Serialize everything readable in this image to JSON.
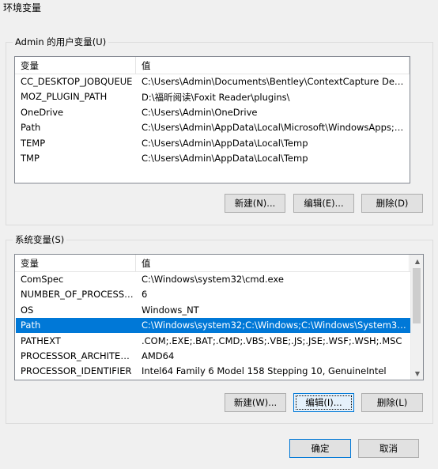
{
  "window": {
    "title": "环境变量"
  },
  "user_section": {
    "label": "Admin 的用户变量(U)",
    "columns": [
      "变量",
      "值"
    ],
    "rows": [
      {
        "name": "CC_DESKTOP_JOBQUEUE",
        "value": "C:\\Users\\Admin\\Documents\\Bentley\\ContextCapture Desktop..."
      },
      {
        "name": "MOZ_PLUGIN_PATH",
        "value": "D:\\福昕阅读\\Foxit Reader\\plugins\\"
      },
      {
        "name": "OneDrive",
        "value": "C:\\Users\\Admin\\OneDrive"
      },
      {
        "name": "Path",
        "value": "C:\\Users\\Admin\\AppData\\Local\\Microsoft\\WindowsApps;C:\\..."
      },
      {
        "name": "TEMP",
        "value": "C:\\Users\\Admin\\AppData\\Local\\Temp"
      },
      {
        "name": "TMP",
        "value": "C:\\Users\\Admin\\AppData\\Local\\Temp"
      }
    ],
    "buttons": {
      "new": "新建(N)...",
      "edit": "编辑(E)...",
      "delete": "删除(D)"
    }
  },
  "system_section": {
    "label": "系统变量(S)",
    "columns": [
      "变量",
      "值"
    ],
    "rows": [
      {
        "name": "ComSpec",
        "value": "C:\\Windows\\system32\\cmd.exe"
      },
      {
        "name": "NUMBER_OF_PROCESSORS",
        "value": "6"
      },
      {
        "name": "OS",
        "value": "Windows_NT"
      },
      {
        "name": "Path",
        "value": "C:\\Windows\\system32;C:\\Windows;C:\\Windows\\System32\\Wb..."
      },
      {
        "name": "PATHEXT",
        "value": ".COM;.EXE;.BAT;.CMD;.VBS;.VBE;.JS;.JSE;.WSF;.WSH;.MSC"
      },
      {
        "name": "PROCESSOR_ARCHITECT...",
        "value": "AMD64"
      },
      {
        "name": "PROCESSOR_IDENTIFIER",
        "value": "Intel64 Family 6 Model 158 Stepping 10, GenuineIntel"
      }
    ],
    "selected_index": 3,
    "buttons": {
      "new": "新建(W)...",
      "edit": "编辑(I)...",
      "delete": "删除(L)"
    }
  },
  "dialog_buttons": {
    "ok": "确定",
    "cancel": "取消"
  },
  "icons": {
    "scroll_up": "chevron-up-icon",
    "scroll_down": "chevron-down-icon"
  }
}
